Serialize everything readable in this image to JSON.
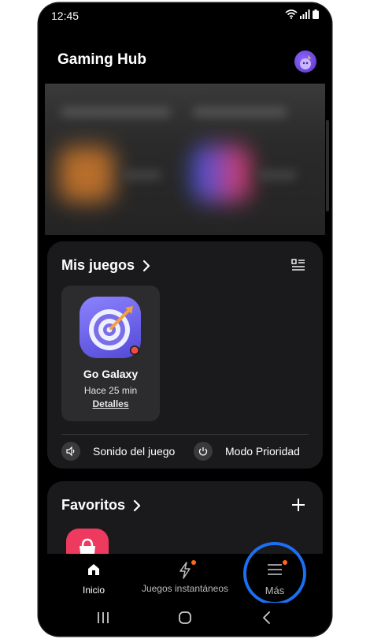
{
  "status_bar": {
    "time": "12:45"
  },
  "header": {
    "title": "Gaming Hub"
  },
  "my_games": {
    "title": "Mis juegos",
    "games": [
      {
        "name": "Go Galaxy",
        "last_played": "Hace 25 min",
        "details_label": "Detalles"
      }
    ],
    "quick_settings": [
      {
        "label": "Sonido del juego",
        "icon": "speaker-icon"
      },
      {
        "label": "Modo Prioridad",
        "icon": "power-icon"
      }
    ]
  },
  "favorites": {
    "title": "Favoritos",
    "add_icon": "plus-icon"
  },
  "bottom_nav": {
    "items": [
      {
        "label": "Inicio",
        "icon": "home-icon"
      },
      {
        "label": "Juegos instantáneos",
        "icon": "lightning-icon"
      },
      {
        "label": "Más",
        "icon": "menu-icon"
      }
    ]
  },
  "colors": {
    "background": "#000000",
    "card": "#1a1a1c",
    "highlight_ring": "#1d6ff2",
    "notification_dot": "#ff6a1a"
  }
}
